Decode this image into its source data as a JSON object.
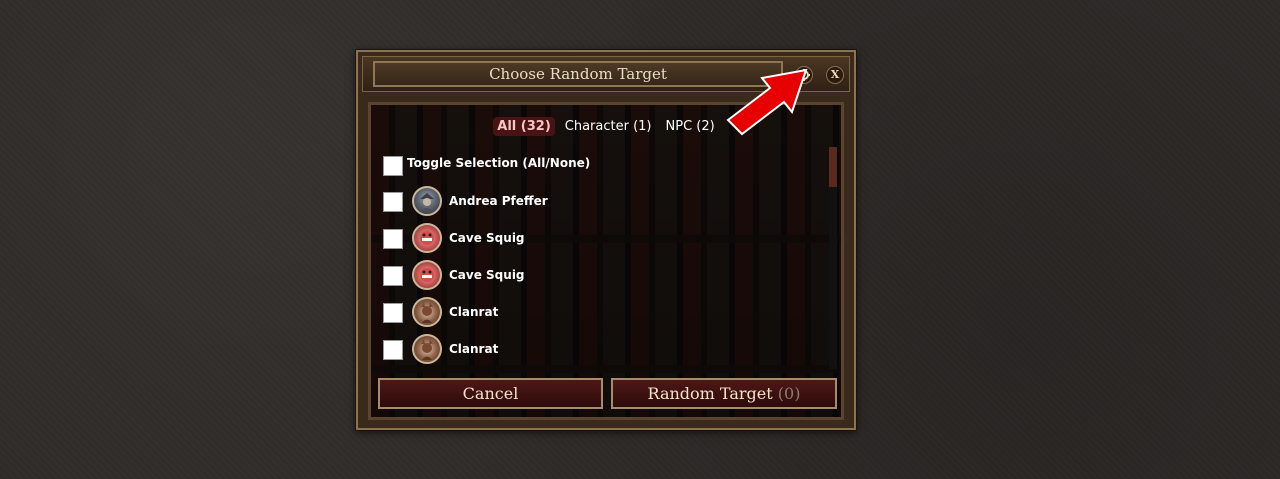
{
  "dialog": {
    "title": "Choose Random Target",
    "close_label": "X",
    "icons": {
      "settings": "gear-icon",
      "close": "close-icon"
    }
  },
  "tabs": [
    {
      "label": "All (32)",
      "active": true
    },
    {
      "label": "Character (1)",
      "active": false
    },
    {
      "label": "NPC (2)",
      "active": false
    }
  ],
  "toggle": {
    "label": "Toggle Selection (All/None)",
    "checked": false
  },
  "targets": [
    {
      "name": "Andrea Pfeffer",
      "checked": false
    },
    {
      "name": "Cave Squig",
      "checked": false
    },
    {
      "name": "Cave Squig",
      "checked": false
    },
    {
      "name": "Clanrat",
      "checked": false
    },
    {
      "name": "Clanrat",
      "checked": false
    }
  ],
  "footer": {
    "cancel_label": "Cancel",
    "random_label": "Random Target",
    "random_count": "(0)"
  },
  "colors": {
    "active_tab_bg": "#4a1313",
    "button_bg": "#4e1717",
    "annotation_arrow": "#e60000"
  }
}
